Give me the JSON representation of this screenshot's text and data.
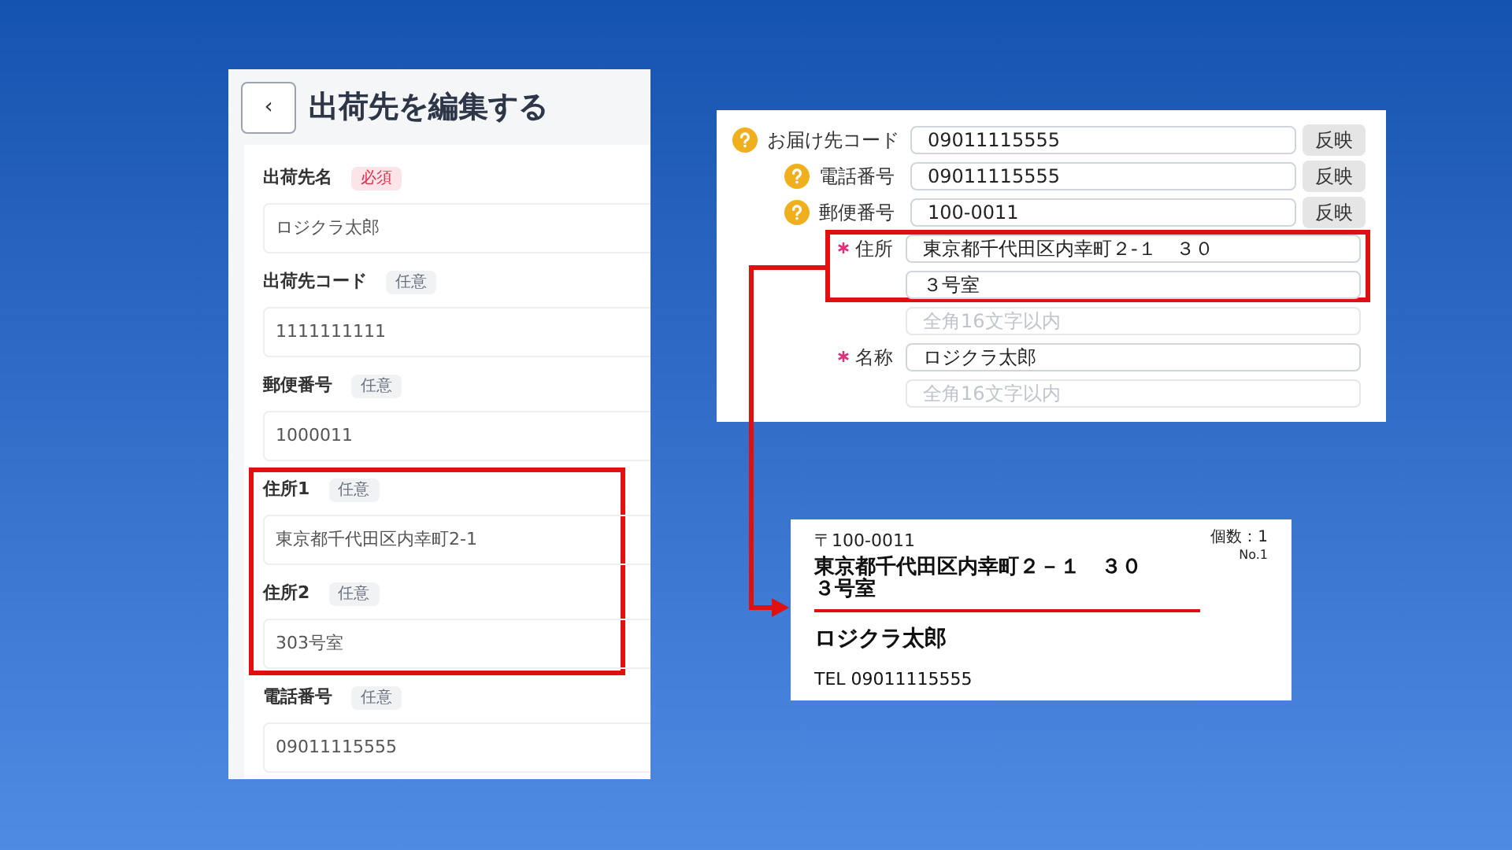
{
  "edit_panel": {
    "back": "‹",
    "title": "出荷先を編集する",
    "fields": [
      {
        "label": "出荷先名",
        "tag": {
          "text": "必須",
          "kind": "required"
        },
        "value": "ロジクラ太郎",
        "highlighted": false
      },
      {
        "label": "出荷先コード",
        "tag": {
          "text": "任意",
          "kind": "optional"
        },
        "value": "1111111111",
        "highlighted": false
      },
      {
        "label": "郵便番号",
        "tag": {
          "text": "任意",
          "kind": "optional"
        },
        "value": "1000011",
        "highlighted": false
      },
      {
        "label": "住所1",
        "tag": {
          "text": "任意",
          "kind": "optional"
        },
        "value": "東京都千代田区内幸町2-1",
        "highlighted": true
      },
      {
        "label": "住所2",
        "tag": {
          "text": "任意",
          "kind": "optional"
        },
        "value": "303号室",
        "highlighted": true
      },
      {
        "label": "電話番号",
        "tag": {
          "text": "任意",
          "kind": "optional"
        },
        "value": "09011115555",
        "highlighted": false
      }
    ]
  },
  "delivery_form": {
    "rows": [
      {
        "kind": "help",
        "label": "お届け先コード",
        "value": "09011115555",
        "button": "反映"
      },
      {
        "kind": "help",
        "label": "電話番号",
        "value": "09011115555",
        "button": "反映"
      },
      {
        "kind": "help",
        "label": "郵便番号",
        "value": "100-0011",
        "button": "反映"
      },
      {
        "kind": "required",
        "label": "住所",
        "value": "東京都千代田区内幸町２-１　３０",
        "highlighted": true
      },
      {
        "kind": "blank",
        "value": "３号室",
        "highlighted": true
      },
      {
        "kind": "blank",
        "placeholder": "全角16文字以内",
        "highlighted": false
      },
      {
        "kind": "required",
        "label": "名称",
        "value": "ロジクラ太郎",
        "highlighted": false
      },
      {
        "kind": "blank",
        "placeholder": "全角16文字以内",
        "highlighted": false
      }
    ]
  },
  "shipping_label": {
    "postal": "〒100-0011",
    "count": "個数：1",
    "number": "No.1",
    "address_lines": [
      "東京都千代田区内幸町２－１　３０",
      "３号室"
    ],
    "name": "ロジクラ太郎",
    "tel": "TEL 09011115555"
  }
}
